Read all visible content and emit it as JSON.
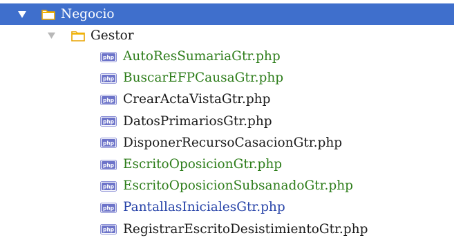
{
  "tree": {
    "root": {
      "label": "Negocio",
      "icon": "folder-icon",
      "expanded": true,
      "selected": true,
      "selected_color": "#3f6fcc"
    },
    "child": {
      "label": "Gestor",
      "icon": "folder-icon",
      "expanded": true
    },
    "files": [
      {
        "name": "AutoResSumariaGtr.php",
        "icon": "php-file-icon",
        "status": "added",
        "color": "#2d7d1a"
      },
      {
        "name": "BuscarEFPCausaGtr.php",
        "icon": "php-file-icon",
        "status": "added",
        "color": "#2d7d1a"
      },
      {
        "name": "CrearActaVistaGtr.php",
        "icon": "php-file-icon",
        "status": "unchanged",
        "color": "#1a1a1a"
      },
      {
        "name": "DatosPrimariosGtr.php",
        "icon": "php-file-icon",
        "status": "unchanged",
        "color": "#1a1a1a"
      },
      {
        "name": "DisponerRecursoCasacionGtr.php",
        "icon": "php-file-icon",
        "status": "unchanged",
        "color": "#1a1a1a"
      },
      {
        "name": "EscritoOposicionGtr.php",
        "icon": "php-file-icon",
        "status": "added",
        "color": "#2d7d1a"
      },
      {
        "name": "EscritoOposicionSubsanadoGtr.php",
        "icon": "php-file-icon",
        "status": "added",
        "color": "#2d7d1a"
      },
      {
        "name": "PantallasInicialesGtr.php",
        "icon": "php-file-icon",
        "status": "modified",
        "color": "#2743a8"
      },
      {
        "name": "RegistrarEscritoDesistimientoGtr.php",
        "icon": "php-file-icon",
        "status": "unchanged",
        "color": "#1a1a1a"
      }
    ]
  }
}
